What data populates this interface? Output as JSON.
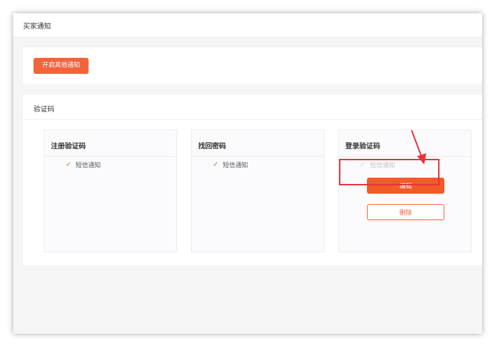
{
  "topbar": {
    "title": "买家通知"
  },
  "actions": {
    "open_other_label": "开启其他通知"
  },
  "section": {
    "title": "验证码"
  },
  "cards": [
    {
      "title": "注册验证码",
      "item": "短信通知"
    },
    {
      "title": "找回密码",
      "item": "短信通知"
    },
    {
      "title": "登录验证码",
      "item": "短信通知",
      "edit_label": "编辑",
      "delete_label": "删除"
    }
  ],
  "colors": {
    "accent": "#f4643c",
    "highlight": "#e8323c"
  },
  "icons": {
    "check": "check-icon"
  }
}
